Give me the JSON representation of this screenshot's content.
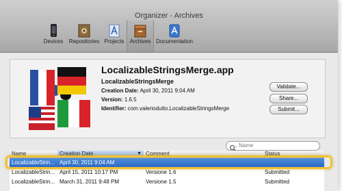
{
  "window": {
    "title": "Organizer - Archives"
  },
  "toolbar": {
    "items": [
      {
        "label": "Devices",
        "icon": "iphone-icon"
      },
      {
        "label": "Repositories",
        "icon": "repositories-icon"
      },
      {
        "label": "Projects",
        "icon": "projects-icon"
      },
      {
        "label": "Archives",
        "icon": "archives-icon",
        "selected": true
      },
      {
        "label": "Documentation",
        "icon": "documentation-icon"
      }
    ]
  },
  "detail": {
    "app_name": "LocalizableStringsMerge.app",
    "bundle_name": "LocalizableStringsMerge",
    "creation_date_label": "Creation Date:",
    "creation_date": "April 30, 2011 9:04 AM",
    "version_label": "Version:",
    "version": "1.6.5",
    "identifier_label": "Identifier:",
    "identifier": "com.valeriodutto.LocalizableStringsMerge",
    "buttons": {
      "validate": "Validate...",
      "share": "Share...",
      "submit": "Submit..."
    }
  },
  "search": {
    "placeholder": "Name"
  },
  "table": {
    "headers": {
      "name": "Name",
      "creation_date": "Creation Date",
      "comment": "Comment",
      "status": "Status"
    },
    "rows": [
      {
        "name": "LocalizableStrin...",
        "creation_date": "April 30, 2011 9:04 AM",
        "comment": "",
        "status": ""
      },
      {
        "name": "LocalizableStrin...",
        "creation_date": "April 15, 2011 10:17 PM",
        "comment": "Versione 1.6",
        "status": "Submitted"
      },
      {
        "name": "LocalizableStrin...",
        "creation_date": "March 31, 2011 9:48 PM",
        "comment": "Versione 1.5",
        "status": "Submitted"
      }
    ]
  },
  "colors": {
    "selection": "#2a66c5",
    "highlight": "#f0c233"
  }
}
